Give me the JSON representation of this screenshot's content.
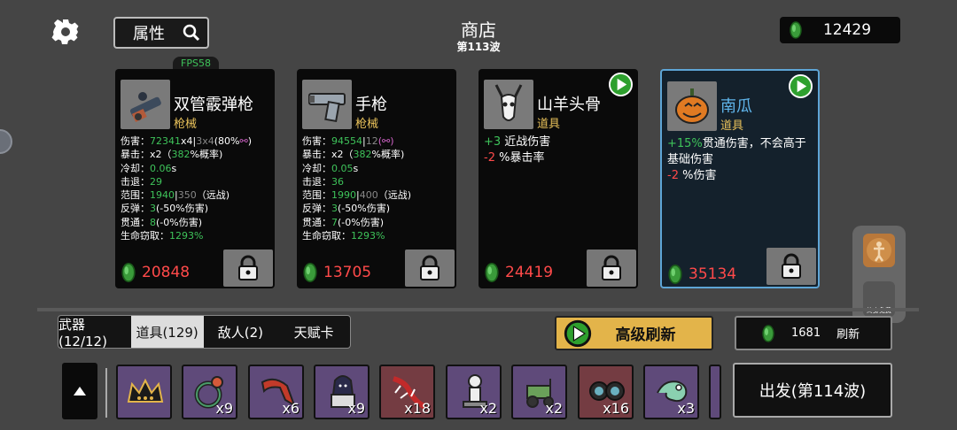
{
  "header": {
    "search_label": "属性",
    "title": "商店",
    "wave": "第113波",
    "money": "12429",
    "fps": "FPS58"
  },
  "cards": [
    {
      "name": "双管霰弹枪",
      "type": "枪械",
      "price": "20848",
      "icon": "double-barrel-shotgun-icon",
      "stats": [
        {
          "label": "伤害：",
          "v1": "72341",
          "v2": "x4",
          "sep": "|",
          "v3": "3x4",
          "v4": "(80%",
          "v5": "⚯",
          ")": ")"
        },
        {
          "label": "暴击：",
          "text": "x2（",
          "g": "382",
          "rest": "%概率)"
        },
        {
          "label": "冷却：",
          "g": "0.06",
          "rest": "s"
        },
        {
          "label": "击退：",
          "g": "29"
        },
        {
          "label": "范围：",
          "g": "1940",
          "sep": "|",
          "gray": "350",
          "rest": "（远战)"
        },
        {
          "label": "反弹：",
          "g": "3",
          "rest": "(-50%伤害)"
        },
        {
          "label": "贯通：",
          "g": "8",
          "rest": "(-0%伤害)"
        },
        {
          "label": "生命窃取：",
          "g": "1293%"
        }
      ]
    },
    {
      "name": "手枪",
      "type": "枪械",
      "price": "13705",
      "icon": "pistol-icon",
      "stats": [
        {
          "label": "伤害：",
          "g": "94554",
          "sep": "|",
          "gray": "12",
          "rest": "(⚯)"
        },
        {
          "label": "暴击：",
          "text": "x2（",
          "g": "382",
          "rest": "%概率)"
        },
        {
          "label": "冷却：",
          "g": "0.05",
          "rest": "s"
        },
        {
          "label": "击退：",
          "g": "36"
        },
        {
          "label": "范围：",
          "g": "1990",
          "sep": "|",
          "gray": "400",
          "rest": "（远战)"
        },
        {
          "label": "反弹：",
          "g": "3",
          "rest": "(-50%伤害)"
        },
        {
          "label": "贯通：",
          "g": "7",
          "rest": "(-0%伤害)"
        },
        {
          "label": "生命窃取：",
          "g": "1293%"
        }
      ]
    },
    {
      "name": "山羊头骨",
      "type": "道具",
      "price": "24419",
      "icon": "goat-skull-icon",
      "desc": [
        {
          "v": "+3",
          "cls": "g",
          "t": " 近战伤害"
        },
        {
          "v": "-2",
          "cls": "r",
          "t": " %暴击率"
        }
      ]
    },
    {
      "name": "南瓜",
      "type": "道具",
      "price": "35134",
      "icon": "pumpkin-icon",
      "desc": [
        {
          "v": "+15%",
          "cls": "g",
          "t": "贯通伤害，不会高于"
        },
        {
          "v": "",
          "cls": "g",
          "t": "基础伤害"
        },
        {
          "v": "-2",
          "cls": "r",
          "t": " %伤害"
        }
      ]
    }
  ],
  "tabs": [
    "武器(12/12)",
    "道具(129)",
    "敌人(2)",
    "天赋卡"
  ],
  "active_tab": 1,
  "advanced_refresh": "高级刷新",
  "refresh": {
    "cost": "1681",
    "label": "刷新"
  },
  "go_button": "出发(第114波)",
  "side": {
    "label": "终身免费"
  },
  "inventory": [
    {
      "icon": "crown-icon",
      "count": "",
      "red": false
    },
    {
      "icon": "ring-icon",
      "count": "x9",
      "red": false
    },
    {
      "icon": "scarf-icon",
      "count": "x6",
      "red": false
    },
    {
      "icon": "hooded-figure-icon",
      "count": "x9",
      "red": false
    },
    {
      "icon": "lizard-icon",
      "count": "x18",
      "red": true
    },
    {
      "icon": "statue-icon",
      "count": "x2",
      "red": false
    },
    {
      "icon": "tractor-icon",
      "count": "x2",
      "red": false
    },
    {
      "icon": "binoculars-icon",
      "count": "x16",
      "red": false
    },
    {
      "icon": "chameleon-icon",
      "count": "x3",
      "red": false
    }
  ]
}
